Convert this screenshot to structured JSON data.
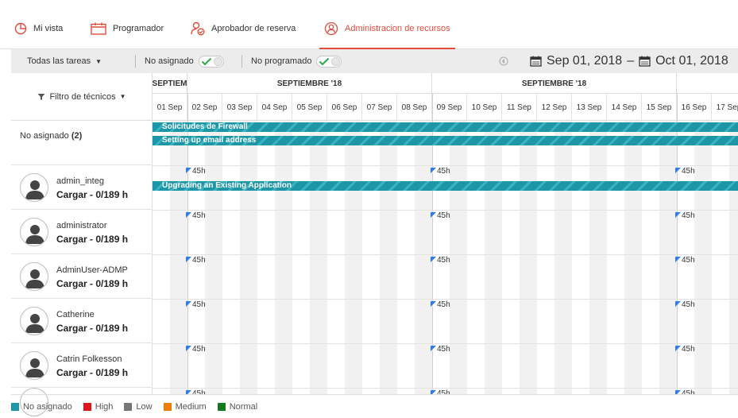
{
  "tabs": [
    {
      "label": "Mi vista",
      "icon": "pie-chart-icon"
    },
    {
      "label": "Programador",
      "icon": "calendar-icon"
    },
    {
      "label": "Aprobador de reserva",
      "icon": "user-check-icon"
    },
    {
      "label": "Administracion de recursos",
      "icon": "resource-admin-icon"
    }
  ],
  "toolbar": {
    "tasks_dropdown": "Todas las tareas",
    "unassigned_toggle": "No asignado",
    "unscheduled_toggle": "No programado",
    "date_from": "Sep 01, 2018",
    "date_dash": "–",
    "date_to": "Oct 01, 2018"
  },
  "filter_label": "Filtro de técnicos",
  "months": [
    "SEPTIEM",
    "SEPTIEMBRE '18",
    "SEPTIEMBRE '18"
  ],
  "days": [
    "01 Sep",
    "02 Sep",
    "03 Sep",
    "04 Sep",
    "05 Sep",
    "06 Sep",
    "07 Sep",
    "08 Sep",
    "09 Sep",
    "10 Sep",
    "11 Sep",
    "12 Sep",
    "13 Sep",
    "14 Sep",
    "15 Sep",
    "16 Sep",
    "17 Sep"
  ],
  "unassigned": {
    "label": "No asignado",
    "count": "(2)",
    "tasks": [
      "Solicitudes de Firewall",
      "Setting up email address"
    ]
  },
  "technicians": [
    {
      "name": "admin_integ",
      "load": "Cargar - 0/189 h",
      "task": "Upgrading an Existing Application"
    },
    {
      "name": "administrator",
      "load": "Cargar - 0/189 h"
    },
    {
      "name": "AdminUser-ADMP",
      "load": "Cargar - 0/189 h"
    },
    {
      "name": "Catherine",
      "load": "Cargar - 0/189 h"
    },
    {
      "name": "Catrin Folkesson",
      "load": "Cargar - 0/189 h"
    }
  ],
  "week_marker": "45h",
  "legend": [
    {
      "label": "No asignado",
      "color": "#1d97a8"
    },
    {
      "label": "High",
      "color": "#e0141e"
    },
    {
      "label": "Low",
      "color": "#777777"
    },
    {
      "label": "Medium",
      "color": "#f07d00"
    },
    {
      "label": "Normal",
      "color": "#157a1f"
    }
  ],
  "colors": {
    "accent": "#e04b3b",
    "toggle_check": "#2aa84a",
    "marker": "#2e7de0"
  }
}
